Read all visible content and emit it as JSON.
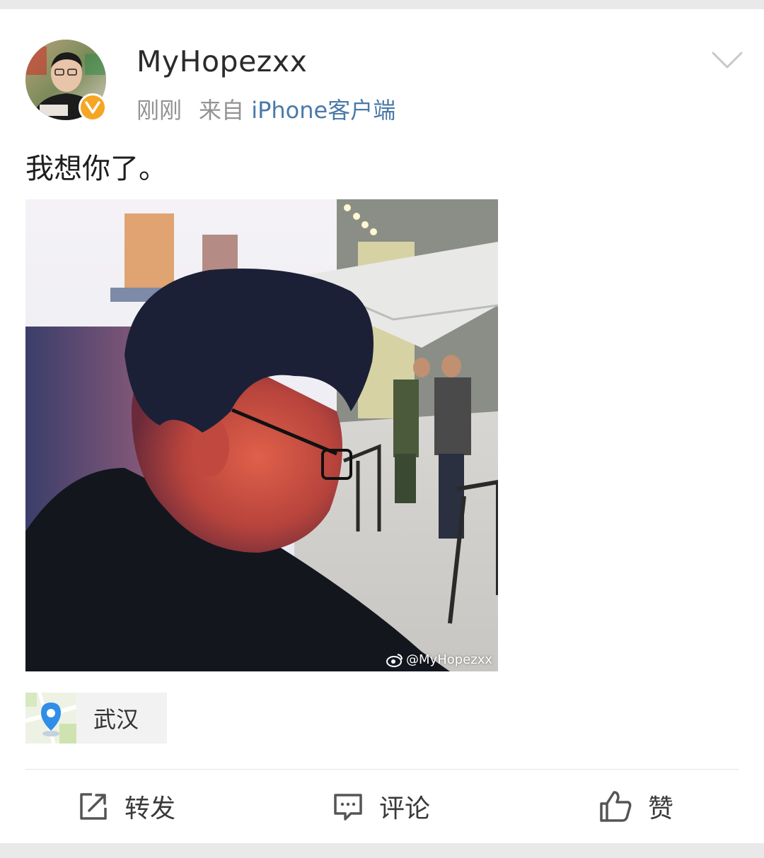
{
  "post": {
    "author": {
      "username": "MyHopezxx",
      "verified": true,
      "verified_badge_color": "#f5a623"
    },
    "timestamp": "刚刚",
    "source_prefix": "来自",
    "source": "iPhone客户端",
    "text": "我想你了。",
    "image": {
      "watermark": "@MyHopezxx"
    },
    "location": {
      "name": "武汉",
      "icon": "map-pin-icon"
    }
  },
  "actions": {
    "repost": {
      "label": "转发",
      "icon": "share-icon"
    },
    "comment": {
      "label": "评论",
      "icon": "comment-icon"
    },
    "like": {
      "label": "赞",
      "icon": "thumbs-up-icon"
    }
  },
  "colors": {
    "source_link": "#4b7aa8",
    "meta_text": "#939393",
    "background": "#e9e9e9"
  }
}
